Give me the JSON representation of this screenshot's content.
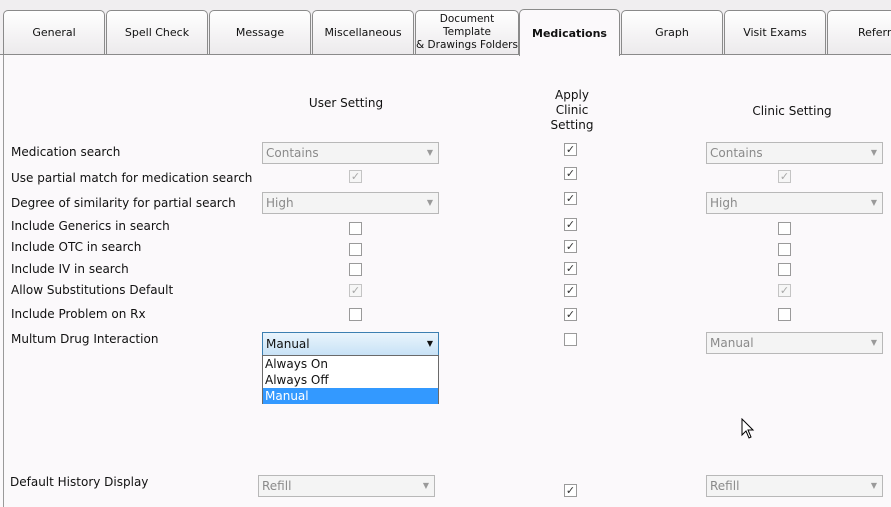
{
  "tabs": [
    {
      "label": "General"
    },
    {
      "label": "Spell Check"
    },
    {
      "label": "Message"
    },
    {
      "label": "Miscellaneous"
    },
    {
      "label": "Document Template\n& Drawings Folders"
    },
    {
      "label": "Medications"
    },
    {
      "label": "Graph"
    },
    {
      "label": "Visit Exams"
    },
    {
      "label": "Referra"
    }
  ],
  "active_tab": "Medications",
  "columns": {
    "user": "User Setting",
    "apply": "Apply\nClinic\nSetting",
    "clinic": "Clinic Setting"
  },
  "rows": {
    "medication_search": {
      "label": "Medication search",
      "user": "Contains",
      "apply": true,
      "clinic": "Contains"
    },
    "partial_match": {
      "label": "Use partial match for medication search",
      "user": true,
      "apply": true,
      "clinic": true
    },
    "similarity": {
      "label": "Degree of similarity for partial search",
      "user": "High",
      "apply": true,
      "clinic": "High"
    },
    "generics": {
      "label": "Include Generics in search",
      "user": false,
      "apply": true,
      "clinic": false
    },
    "otc": {
      "label": "Include OTC in search",
      "user": false,
      "apply": true,
      "clinic": false
    },
    "iv": {
      "label": "Include IV in search",
      "user": false,
      "apply": true,
      "clinic": false
    },
    "substitutions": {
      "label": "Allow Substitutions Default",
      "user": true,
      "apply": true,
      "clinic": true
    },
    "problem_on_rx": {
      "label": "Include Problem on Rx",
      "user": false,
      "apply": true,
      "clinic": false
    },
    "multum": {
      "label": "Multum Drug Interaction",
      "user": "Manual",
      "apply": false,
      "clinic": "Manual",
      "options": [
        "Always On",
        "Always Off",
        "Manual"
      ]
    },
    "history": {
      "label": "Default History Display",
      "user": "Refill",
      "apply": true,
      "clinic": "Refill"
    }
  },
  "icons": {
    "dropdown_arrow": "▼",
    "check": "✓",
    "cursor": "mouse-pointer"
  },
  "colors": {
    "selection": "#3399ff",
    "focus_border": "#3c7fb1"
  }
}
